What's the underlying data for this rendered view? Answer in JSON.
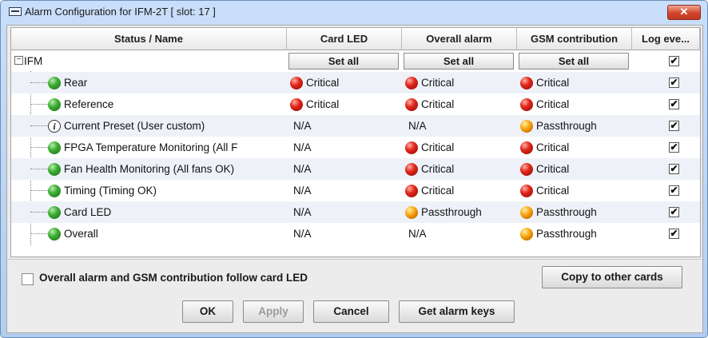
{
  "window": {
    "title": "Alarm Configuration for IFM-2T [ slot: 17 ]",
    "close_label": "✕"
  },
  "columns": [
    "Status / Name",
    "Card LED",
    "Overall alarm",
    "GSM contribution",
    "Log eve..."
  ],
  "root": {
    "label": "IFM",
    "expander": "−",
    "set_all_label": "Set all",
    "log_checked": "✔"
  },
  "rows": [
    {
      "name": "Rear",
      "status_icon": "green",
      "card_led": {
        "text": "Critical",
        "icon": "red"
      },
      "overall": {
        "text": "Critical",
        "icon": "red"
      },
      "gsm": {
        "text": "Critical",
        "icon": "red"
      },
      "log": "✔"
    },
    {
      "name": "Reference",
      "status_icon": "green",
      "card_led": {
        "text": "Critical",
        "icon": "red"
      },
      "overall": {
        "text": "Critical",
        "icon": "red"
      },
      "gsm": {
        "text": "Critical",
        "icon": "red"
      },
      "log": "✔"
    },
    {
      "name": "Current Preset (User custom)",
      "status_icon": "info",
      "card_led": {
        "text": "N/A",
        "icon": ""
      },
      "overall": {
        "text": "N/A",
        "icon": ""
      },
      "gsm": {
        "text": "Passthrough",
        "icon": "orange"
      },
      "log": "✔"
    },
    {
      "name": "FPGA Temperature Monitoring (All F",
      "status_icon": "green",
      "card_led": {
        "text": "N/A",
        "icon": ""
      },
      "overall": {
        "text": "Critical",
        "icon": "red"
      },
      "gsm": {
        "text": "Critical",
        "icon": "red"
      },
      "log": "✔"
    },
    {
      "name": "Fan Health Monitoring (All fans OK)",
      "status_icon": "green",
      "card_led": {
        "text": "N/A",
        "icon": ""
      },
      "overall": {
        "text": "Critical",
        "icon": "red"
      },
      "gsm": {
        "text": "Critical",
        "icon": "red"
      },
      "log": "✔"
    },
    {
      "name": "Timing (Timing OK)",
      "status_icon": "green",
      "card_led": {
        "text": "N/A",
        "icon": ""
      },
      "overall": {
        "text": "Critical",
        "icon": "red"
      },
      "gsm": {
        "text": "Critical",
        "icon": "red"
      },
      "log": "✔"
    },
    {
      "name": "Card LED",
      "status_icon": "green",
      "card_led": {
        "text": "N/A",
        "icon": ""
      },
      "overall": {
        "text": "Passthrough",
        "icon": "orange"
      },
      "gsm": {
        "text": "Passthrough",
        "icon": "orange"
      },
      "log": "✔"
    },
    {
      "name": "Overall",
      "status_icon": "green",
      "card_led": {
        "text": "N/A",
        "icon": ""
      },
      "overall": {
        "text": "N/A",
        "icon": ""
      },
      "gsm": {
        "text": "Passthrough",
        "icon": "orange"
      },
      "log": "✔"
    }
  ],
  "info_glyph": "i",
  "follow_label": "Overall alarm and GSM contribution follow card LED",
  "buttons": {
    "copy": "Copy to other cards",
    "ok": "OK",
    "apply": "Apply",
    "cancel": "Cancel",
    "keys": "Get alarm keys"
  },
  "colors": {
    "title_bar": "#c9defa",
    "close": "#d2452c",
    "status_green": "#3fae35",
    "status_red": "#e2271b",
    "status_orange": "#f7a10c"
  }
}
